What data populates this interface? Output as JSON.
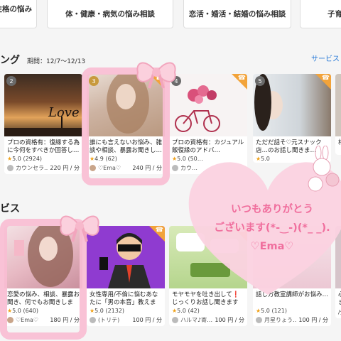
{
  "categories": [
    {
      "label": "人生・性格の悩み相談"
    },
    {
      "label": "体・健康・病気の悩み相談"
    },
    {
      "label": "恋活・婚活・結婚の悩み相談"
    },
    {
      "label": "子育"
    }
  ],
  "ranking": {
    "title": "ング",
    "period": "期間：12/7〜12/13",
    "link": "サービス"
  },
  "section2": {
    "title": "ビス"
  },
  "ranking_cards": [
    {
      "rank": "2",
      "title": "プロの資格有：復縁する為に今何をすべきか回答し…",
      "stars": "★",
      "score": "5.0",
      "reviews": "(2924)",
      "seller": "カウンセラ…",
      "price": "220 円 / 分",
      "has_phone": false
    },
    {
      "rank": "3",
      "title": "誰にも言えないお悩み、雑談や相談、暴露お聞きし…",
      "stars": "★",
      "score": "4.9",
      "reviews": "(62)",
      "seller": "♡Ema♡",
      "price": "240 円 / 分",
      "has_phone": true
    },
    {
      "rank": "4",
      "title": "プロの資格有：カジュアル飯復縁のアドバ…",
      "stars": "★",
      "score": "5.0",
      "reviews": "(50…",
      "seller": "カウ…",
      "price": "",
      "has_phone": true
    },
    {
      "rank": "5",
      "title": "ただだ話そ♡元スナック店…のお話し聞きま…",
      "stars": "★",
      "score": "5.0",
      "reviews": "",
      "seller": "",
      "price": "",
      "has_phone": true
    },
    {
      "rank": "",
      "title": "相",
      "stars": "",
      "score": "",
      "reviews": "",
      "seller": "",
      "price": "",
      "has_phone": false
    }
  ],
  "service_cards": [
    {
      "title": "恋愛の悩み、相談、暴露お聞き、何でもお聞きします…",
      "stars": "★",
      "score": "5.0",
      "reviews": "(640)",
      "seller": "♡Ema♡",
      "price": "180 円 / 分"
    },
    {
      "title": "女性専用/不倫に悩むあなたに「男の本音」教えます…",
      "stars": "★",
      "score": "5.0",
      "reviews": "(2132)",
      "seller": "(トリテ)",
      "price": "100 円 / 分"
    },
    {
      "title": "モヤモヤを吐き出して❗じっくりお話し聞きます 関…",
      "stars": "★",
      "score": "5.0",
      "reviews": "(42)",
      "seller": "ハルマ♪寄…",
      "price": "100 円 / 分"
    },
    {
      "title": "話し方教室講師がお悩み…",
      "stars": "★",
      "score": "5.0",
      "reviews": "(121)",
      "seller": "月星りょう…",
      "price": "100 円 / 分"
    },
    {
      "title": "心の…に伝えま…",
      "stars": "",
      "score": "",
      "reviews": "",
      "seller": "",
      "price": "/分"
    }
  ],
  "overlay": {
    "message_line1": "いつもありがとう",
    "message_line2": "ございます(*-‿-)(*_ _).",
    "message_line3": "♡Ema♡",
    "heart_color": "#fbd2e0",
    "frame_color": "#f8bdd3",
    "text_color": "#f06e9d"
  },
  "colors": {
    "accent_link": "#2a7bd8",
    "star": "#f0a21a",
    "phone_badge": "#f2a33a"
  }
}
